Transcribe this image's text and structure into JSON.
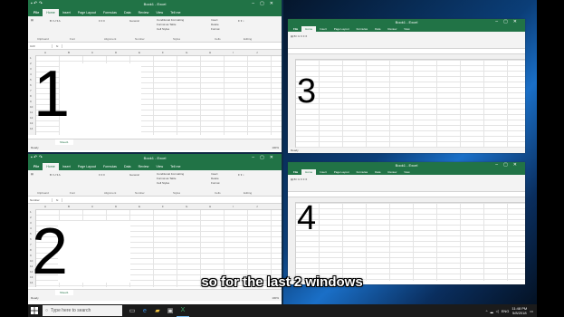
{
  "window_title": "Book1 - Excel",
  "ribbon_tabs": [
    "File",
    "Home",
    "Insert",
    "Page Layout",
    "Formulas",
    "Data",
    "Review",
    "View",
    "Tell me"
  ],
  "active_tab": "Home",
  "ribbon_groups": {
    "clipboard": "Clipboard",
    "font": "Font",
    "alignment": "Alignment",
    "number": "Number",
    "styles": "Styles",
    "cells": "Cells",
    "editing": "Editing"
  },
  "ribbon_buttons": {
    "conditional": "Conditional Formatting",
    "format_table": "Format as Table",
    "cell_styles": "Cell Styles",
    "insert": "Insert",
    "delete": "Delete",
    "format": "Format",
    "general": "General"
  },
  "name_box_1": "C23",
  "name_box_2": "Number",
  "fx_label": "fx",
  "columns": [
    "A",
    "B",
    "C",
    "D",
    "E",
    "F",
    "G",
    "H",
    "I",
    "J",
    "K"
  ],
  "rows": [
    "1",
    "2",
    "3",
    "4",
    "5",
    "6",
    "7",
    "8",
    "9",
    "10",
    "11",
    "12",
    "13",
    "14",
    "15",
    "16",
    "17",
    "18",
    "19",
    "20"
  ],
  "sheet_tab": "Sheet1",
  "status_ready": "Ready",
  "zoom_level": "100%",
  "window_labels": {
    "w1": "1",
    "w2": "2",
    "w3": "3",
    "w4": "4"
  },
  "caption": "so for the last 2 windows",
  "taskbar": {
    "search_placeholder": "Type here to search",
    "time": "11:48 PM",
    "date": "5/8/2018",
    "lang": "ENG"
  },
  "icons": {
    "start": "windows-logo-icon",
    "search": "search-icon",
    "task_view": "task-view-icon",
    "edge": "edge-icon",
    "explorer": "folder-icon",
    "store": "store-icon",
    "excel": "excel-icon"
  },
  "colors": {
    "excel_green": "#217346",
    "taskbar": "#1b1b1b"
  }
}
